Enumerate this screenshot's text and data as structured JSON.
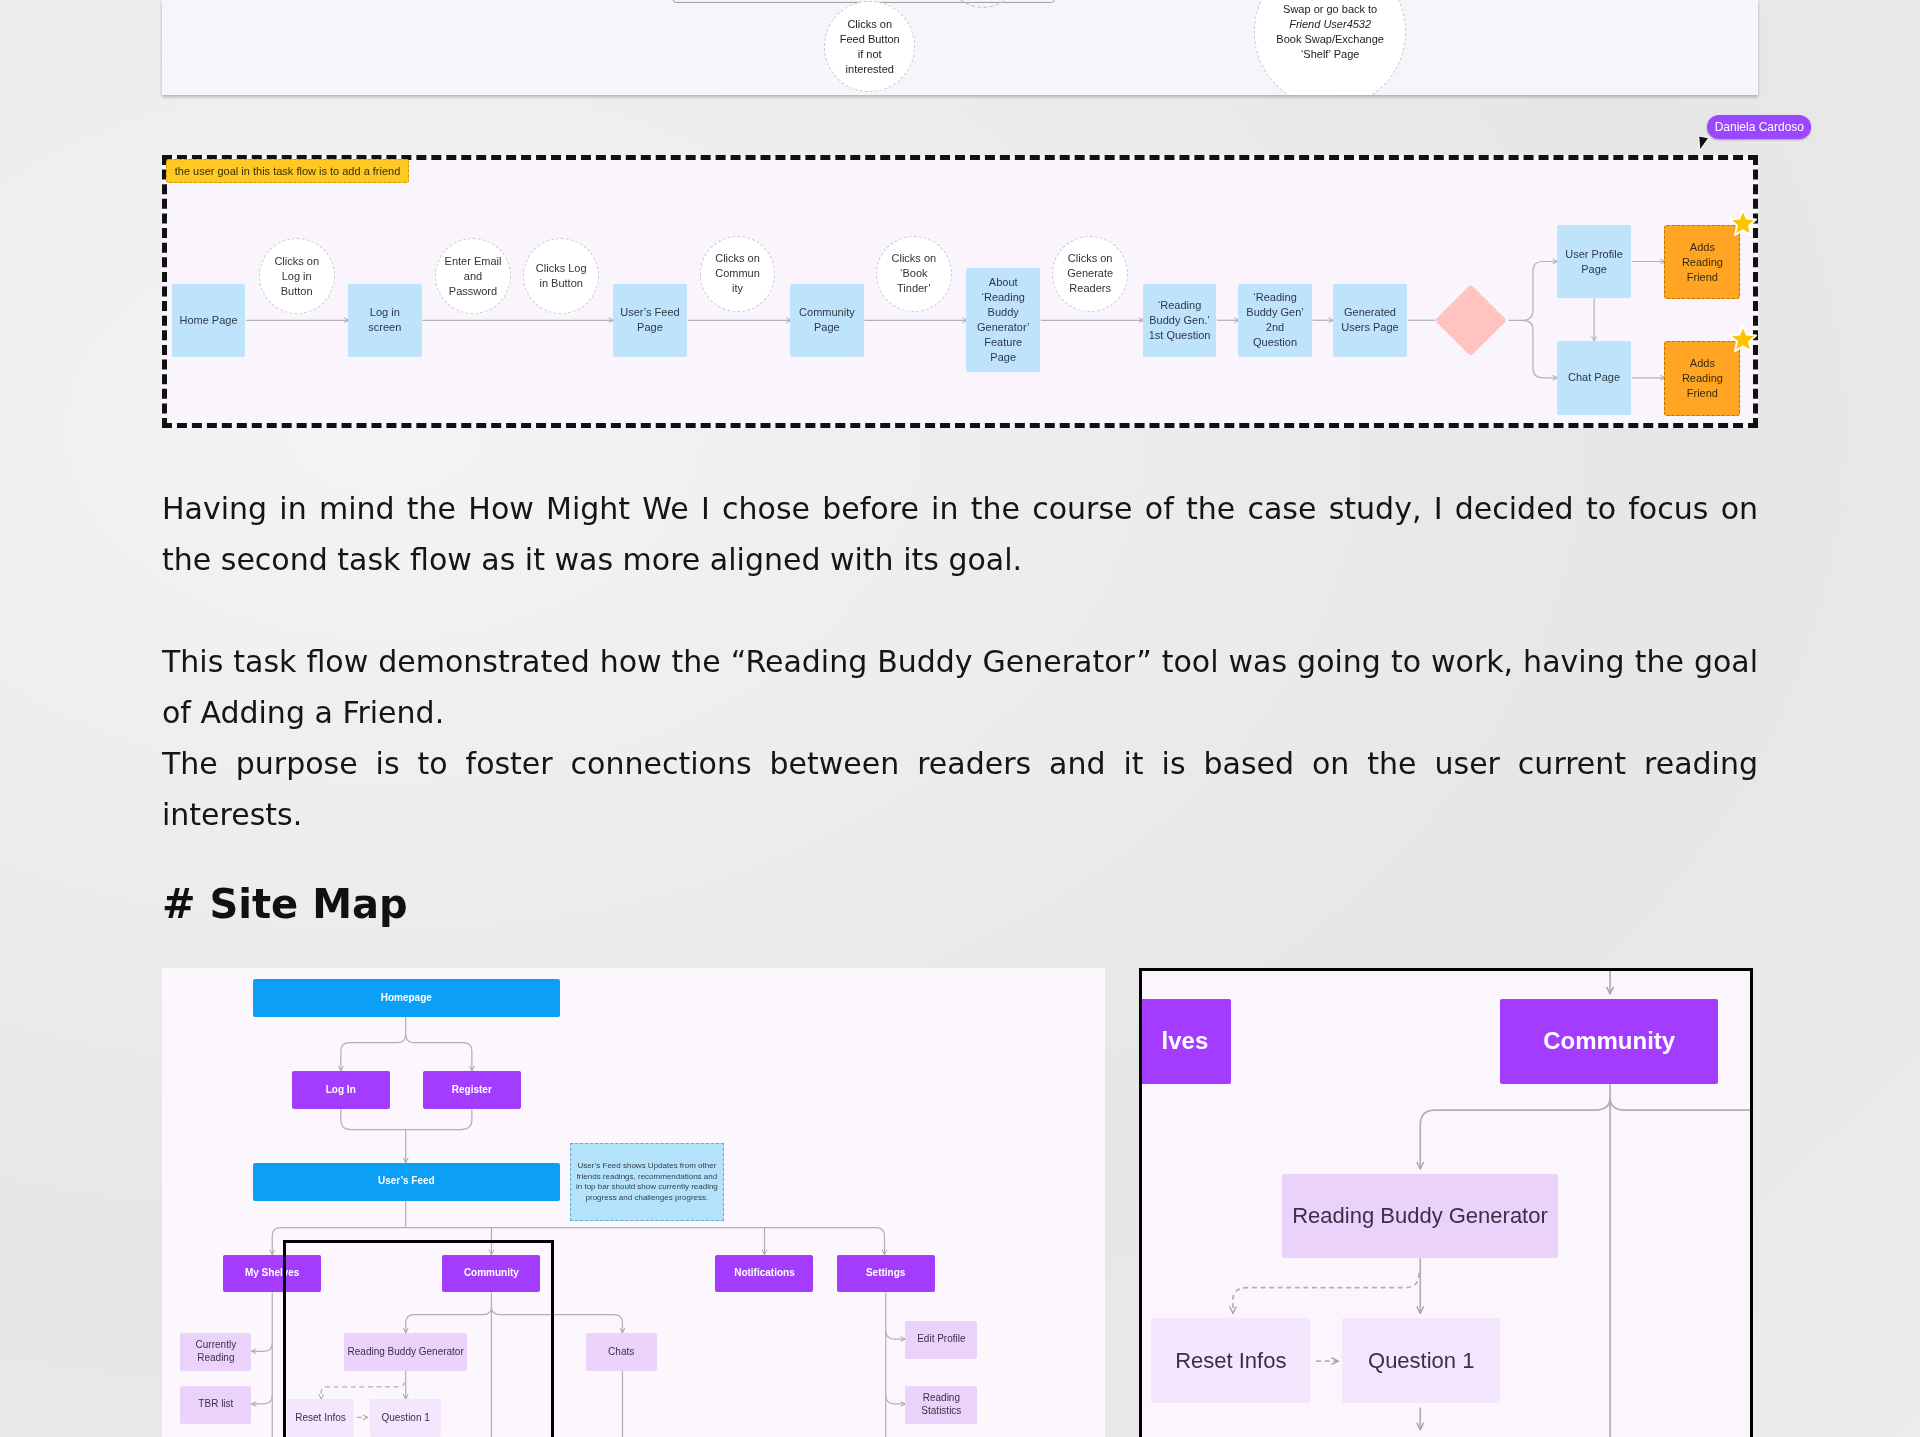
{
  "top_card": {
    "circles": [
      {
        "text": "Clicks on\nFeed Button\nif not\ninterested"
      },
      {
        "text": "Swap or go back to\n*Friend User4532*\nBook Swap/Exchange\n‘Shelf’ Page"
      }
    ]
  },
  "task_flow": {
    "note": "the user goal in this task flow is to add a friend",
    "cursor_label": "Daniela Cardoso",
    "nodes": [
      {
        "kind": "page",
        "text": "Home Page"
      },
      {
        "kind": "action",
        "text": "Clicks on\nLog in\nButton"
      },
      {
        "kind": "page",
        "text": "Log in\nscreen"
      },
      {
        "kind": "action",
        "text": "Enter Email\nand\nPassword"
      },
      {
        "kind": "action",
        "text": "Clicks Log\nin Button"
      },
      {
        "kind": "page",
        "text": "User’s Feed\nPage"
      },
      {
        "kind": "action",
        "text": "Clicks on\nCommun\nity"
      },
      {
        "kind": "page",
        "text": "Community\nPage"
      },
      {
        "kind": "action",
        "text": "Clicks on\n‘Book\nTinder’"
      },
      {
        "kind": "page",
        "text": "About\n‘Reading\nBuddy\nGenerator’\nFeature\nPage"
      },
      {
        "kind": "action",
        "text": "Clicks on\nGenerate\nReaders"
      },
      {
        "kind": "page",
        "text": "‘Reading\nBuddy Gen.’\n1st Question"
      },
      {
        "kind": "page",
        "text": "‘Reading\nBuddy Gen’\n2nd\nQuestion"
      },
      {
        "kind": "page",
        "text": "Generated\nUsers Page"
      },
      {
        "kind": "decision"
      },
      {
        "kind": "page",
        "text": "User Profile\nPage"
      },
      {
        "kind": "page",
        "text": "Chat Page"
      },
      {
        "kind": "goal",
        "text": "Adds\nReading\nFriend",
        "starred": true
      },
      {
        "kind": "goal",
        "text": "Adds\nReading\nFriend",
        "starred": true
      }
    ]
  },
  "paragraphs": [
    {
      "lines": [
        "Having in mind the How Might We I chose before in the course of the case study, I decided to focus on the second task flow as it was more aligned with its goal."
      ]
    },
    {
      "lines": [
        "This task flow demonstrated how the “Reading Buddy Generator” tool was going to work, having the goal of Adding a Friend.",
        "The purpose is to foster connections between readers and it is based on the user current reading interests."
      ]
    }
  ],
  "heading": "# Site Map",
  "site_map": {
    "note": "User’s Feed shows Updates from other friends readings, recommendations and in top bar should show currently reading progress and challenges progress.",
    "nodes": [
      {
        "kind": "main",
        "text": "Homepage"
      },
      {
        "kind": "section",
        "text": "Log In"
      },
      {
        "kind": "section",
        "text": "Register"
      },
      {
        "kind": "main",
        "text": "User’s Feed"
      },
      {
        "kind": "section",
        "text": "My Shelves"
      },
      {
        "kind": "section",
        "text": "Community"
      },
      {
        "kind": "section",
        "text": "Notifications"
      },
      {
        "kind": "section",
        "text": "Settings"
      },
      {
        "kind": "page",
        "text": "Currently\nReading"
      },
      {
        "kind": "page",
        "text": "TBR list"
      },
      {
        "kind": "page",
        "text": "Reading Buddy Generator"
      },
      {
        "kind": "page",
        "text": "Chats"
      },
      {
        "kind": "page",
        "text": "Edit Profile"
      },
      {
        "kind": "page",
        "text": "Reading\nStatistics"
      },
      {
        "kind": "subpage",
        "text": "Reset Infos"
      },
      {
        "kind": "subpage",
        "text": "Question 1"
      }
    ]
  },
  "site_map_detail": {
    "nodes": [
      {
        "kind": "section",
        "text": "lves"
      },
      {
        "kind": "section",
        "text": "Community"
      },
      {
        "kind": "page",
        "text": "Reading Buddy Generator"
      },
      {
        "kind": "subpage",
        "text": "Reset Infos"
      },
      {
        "kind": "subpage",
        "text": "Question 1"
      }
    ]
  }
}
